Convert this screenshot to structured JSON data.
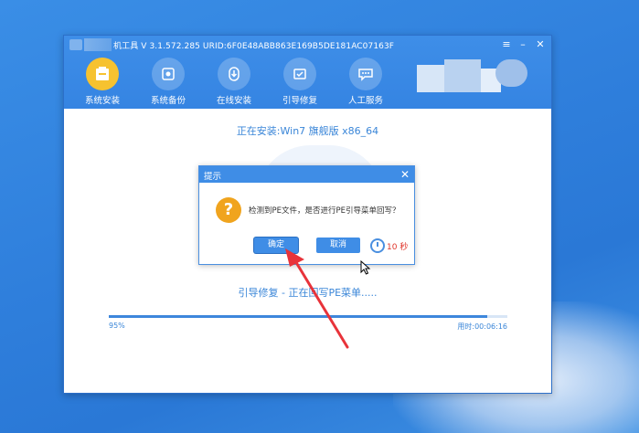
{
  "window": {
    "title": "装机工具 V 3.1.572.285 URID:6F0E48ABB863E169B5DE181AC07163F",
    "title_visible": "机工具 V 3.1.572.285 URID:6F0E48ABB863E169B5DE181AC07163F",
    "controls": {
      "menu": "≡",
      "minimize": "–",
      "close": "✕"
    }
  },
  "nav": {
    "items": [
      {
        "label": "系统安装",
        "icon": "install-icon",
        "active": true
      },
      {
        "label": "系统备份",
        "icon": "backup-icon",
        "active": false
      },
      {
        "label": "在线安装",
        "icon": "download-icon",
        "active": false
      },
      {
        "label": "引导修复",
        "icon": "repair-icon",
        "active": false
      },
      {
        "label": "人工服务",
        "icon": "chat-icon",
        "active": false
      }
    ]
  },
  "main": {
    "status": "正在安装:Win7 旗舰版 x86_64",
    "guide": "引导修复 - 正在回写PE菜单.....",
    "progress": {
      "percent_label": "95%",
      "value": 0.95,
      "elapsed": "用时:00:06:16"
    }
  },
  "dialog": {
    "title": "提示",
    "close": "✕",
    "message": "检测到PE文件，是否进行PE引导菜单回写？",
    "icon": "question-icon",
    "ok_label": "确定",
    "cancel_label": "取消",
    "countdown": "10 秒"
  },
  "colors": {
    "accent": "#3f8de6",
    "active_nav": "#f6c230",
    "countdown": "#e0352b",
    "annotation_arrow": "#e8333a"
  }
}
